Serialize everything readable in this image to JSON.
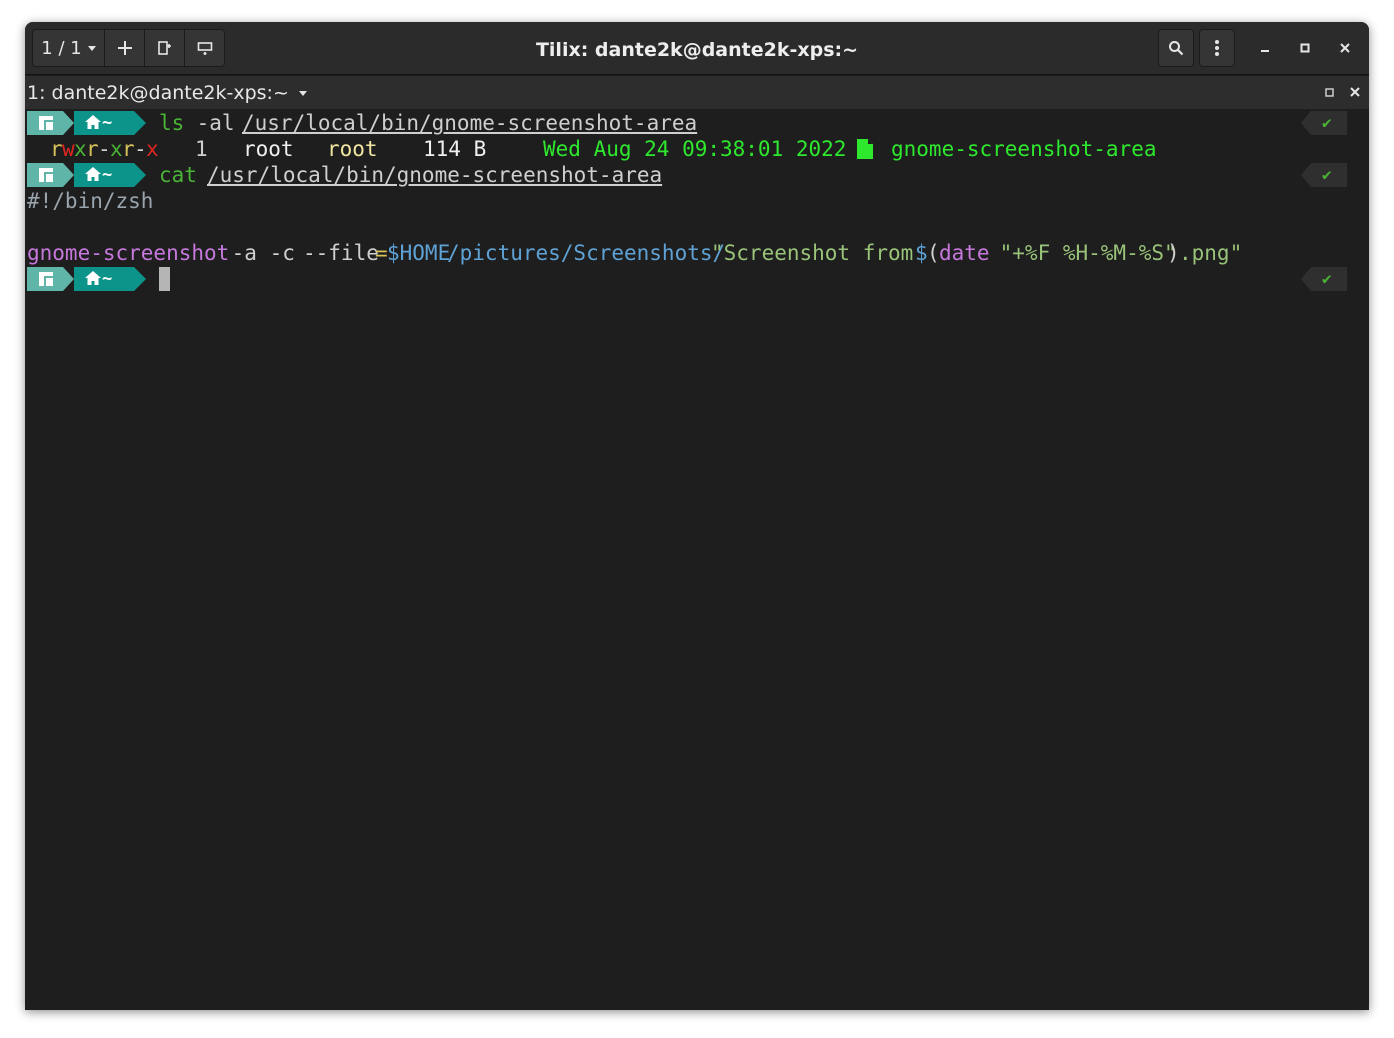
{
  "window": {
    "title": "Tilix: dante2k@dante2k-xps:~",
    "session_count": "1 / 1"
  },
  "terminal_header": {
    "title": "1: dante2k@dante2k-xps:~"
  },
  "prompt": {
    "dir": "~",
    "status_mark": "✔"
  },
  "lines": {
    "cmd1": {
      "name": "ls",
      "args": " -al ",
      "path": "/usr/local/bin/gnome-screenshot-area"
    },
    "ls_out": {
      "perm_r1": "r",
      "perm_w1": "w",
      "perm_x1": "x",
      "perm_r2": "r",
      "perm_d1": "-",
      "perm_x2": "x",
      "perm_r3": "r",
      "perm_d2": "-",
      "perm_x3": "x",
      "links": "1",
      "owner": "root",
      "group": "root",
      "size": "114 B",
      "date": "Wed Aug 24 09:38:01 2022",
      "filename": "gnome-screenshot-area"
    },
    "cmd2": {
      "name": "cat",
      "path": "/usr/local/bin/gnome-screenshot-area"
    },
    "shebang": "#!/bin/zsh",
    "script": {
      "cmd": "gnome-screenshot",
      "opt1": " -a -c ",
      "opt2": "--file",
      "eq": "=",
      "var": "$HOME",
      "path": "/pictures/Screenshots/",
      "str1": "\"Screenshot from ",
      "dollar": "$",
      "paren_open": "(",
      "date": "date",
      "str2": " \"+%F %H-%M-%S\"",
      "paren_close": ")",
      "str3": ".png\""
    }
  },
  "colors": {
    "accent_teal": "#0d948a",
    "os_teal": "#5fb6a8",
    "cmd_green": "#49b436",
    "ls_date_green": "#2ee82e",
    "perm_red": "#e0271f",
    "perm_yellow": "#d7c25a",
    "purple": "#c678dd",
    "blue": "#5fa3d6",
    "string_green": "#98c379"
  },
  "icons": {
    "session": "chevron-down-icon",
    "add": "plus-icon",
    "search": "search-icon",
    "menu": "kebab-menu-icon",
    "minimize": "minimize-icon",
    "maximize": "maximize-icon",
    "close": "close-icon"
  }
}
